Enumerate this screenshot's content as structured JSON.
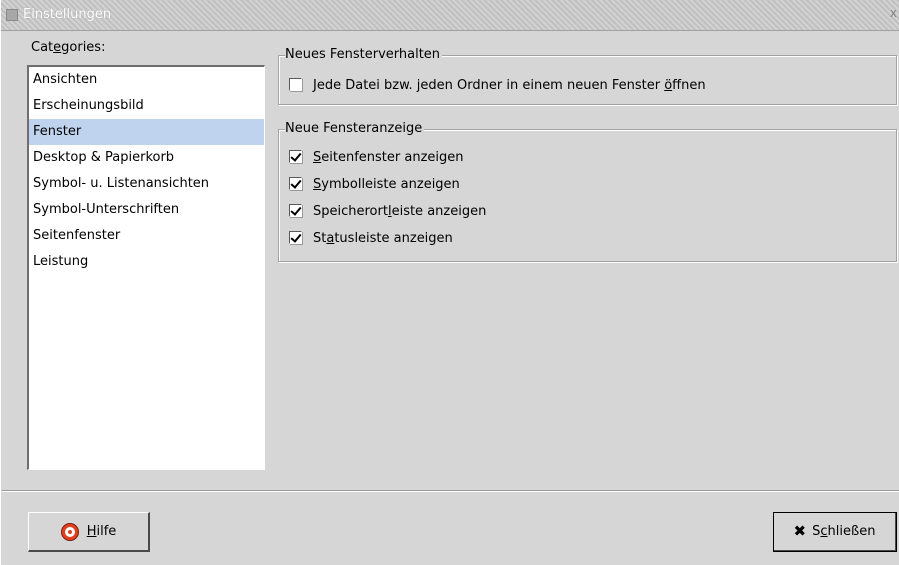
{
  "window": {
    "title": "Einstellungen",
    "close_glyph": "X"
  },
  "categories": {
    "label_pre": "Cat",
    "label_ul": "e",
    "label_post": "gories:",
    "items": [
      {
        "label": "Ansichten"
      },
      {
        "label": "Erscheinungsbild"
      },
      {
        "label": "Fenster",
        "selected": true
      },
      {
        "label": "Desktop & Papierkorb"
      },
      {
        "label": "Symbol- u. Listenansichten"
      },
      {
        "label": "Symbol-Unterschriften"
      },
      {
        "label": "Seitenfenster"
      },
      {
        "label": "Leistung"
      }
    ]
  },
  "group_behavior": {
    "title": "Neues Fensterverhalten",
    "option": {
      "pre": "Jede Datei bzw. jeden Ordner in einem neuen Fenster ",
      "ul": "ö",
      "post": "ffnen",
      "checked": false
    }
  },
  "group_display": {
    "title": "Neue Fensteranzeige",
    "options": [
      {
        "pre": "",
        "ul": "S",
        "post": "eitenfenster anzeigen",
        "checked": true
      },
      {
        "pre": "",
        "ul": "S",
        "post": "ymbolleiste anzeigen",
        "checked": true
      },
      {
        "pre": "Speicherort",
        "ul": "l",
        "post": "eiste anzeigen",
        "checked": true
      },
      {
        "pre": "St",
        "ul": "a",
        "post": "tusleiste anzeigen",
        "checked": true
      }
    ]
  },
  "buttons": {
    "help": {
      "pre": "",
      "ul": "H",
      "post": "ilfe",
      "icon": "lifebuoy-icon"
    },
    "close": {
      "pre": "S",
      "ul": "c",
      "post": "hließen",
      "icon": "close-x-icon"
    }
  }
}
